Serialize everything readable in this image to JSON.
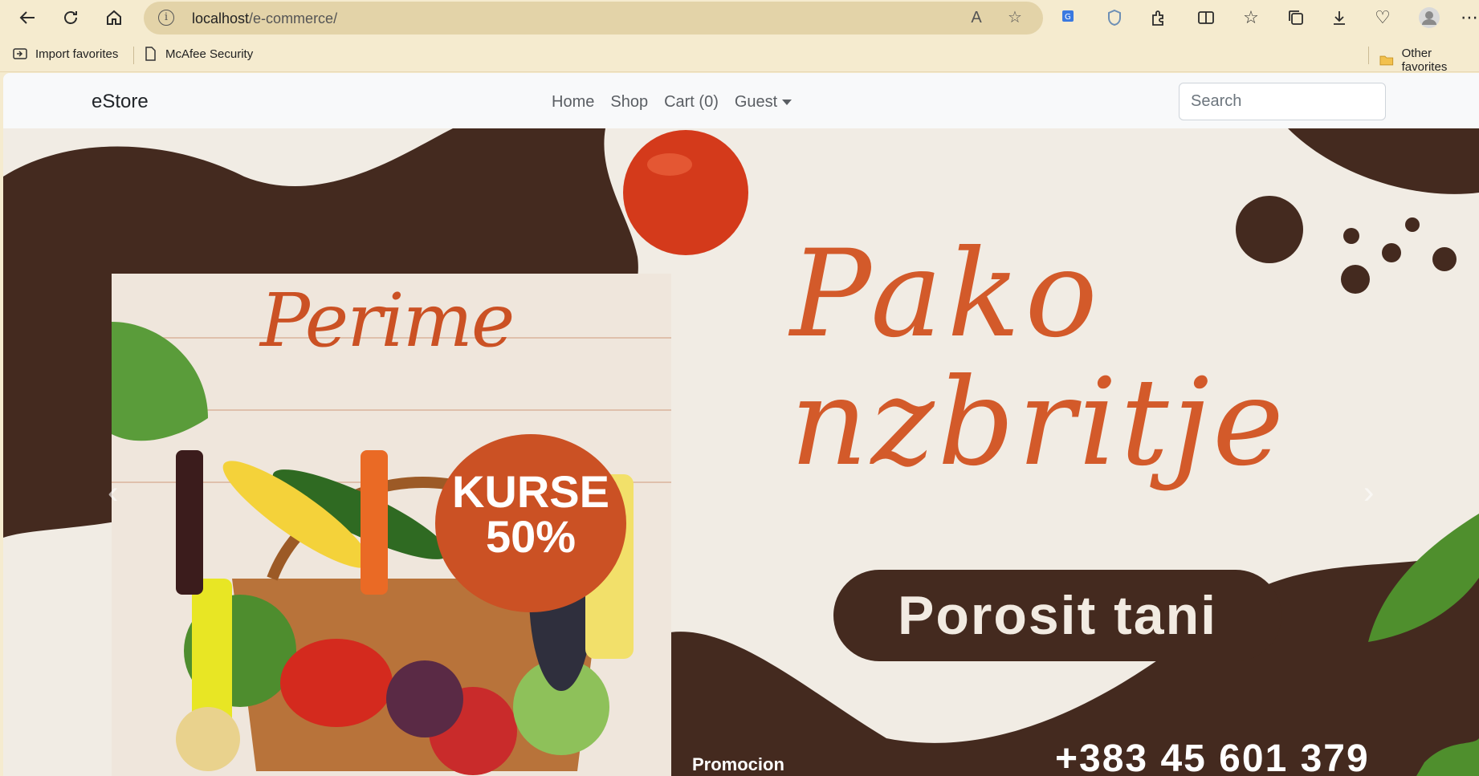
{
  "browser": {
    "url_host": "localhost",
    "url_path": "/e-commerce/",
    "favorites": [
      {
        "label": "Import favorites"
      },
      {
        "label": "McAfee Security"
      }
    ],
    "other_favorites": "Other favorites"
  },
  "navbar": {
    "brand": "eStore",
    "links": {
      "home": "Home",
      "shop": "Shop",
      "cart": "Cart (0)",
      "guest": "Guest"
    },
    "search_placeholder": "Search"
  },
  "banner": {
    "poster_title": "Perime",
    "badge_line1": "KURSE",
    "badge_line2": "50%",
    "headline_line1": "Pako",
    "headline_line2": "nzbritje",
    "cta": "Porosit tani",
    "promo": "Promocion",
    "phone": "+383 45 601 379"
  },
  "colors": {
    "brown": "#442a1f",
    "orange": "#cb5124",
    "cream": "#f1ece4"
  }
}
